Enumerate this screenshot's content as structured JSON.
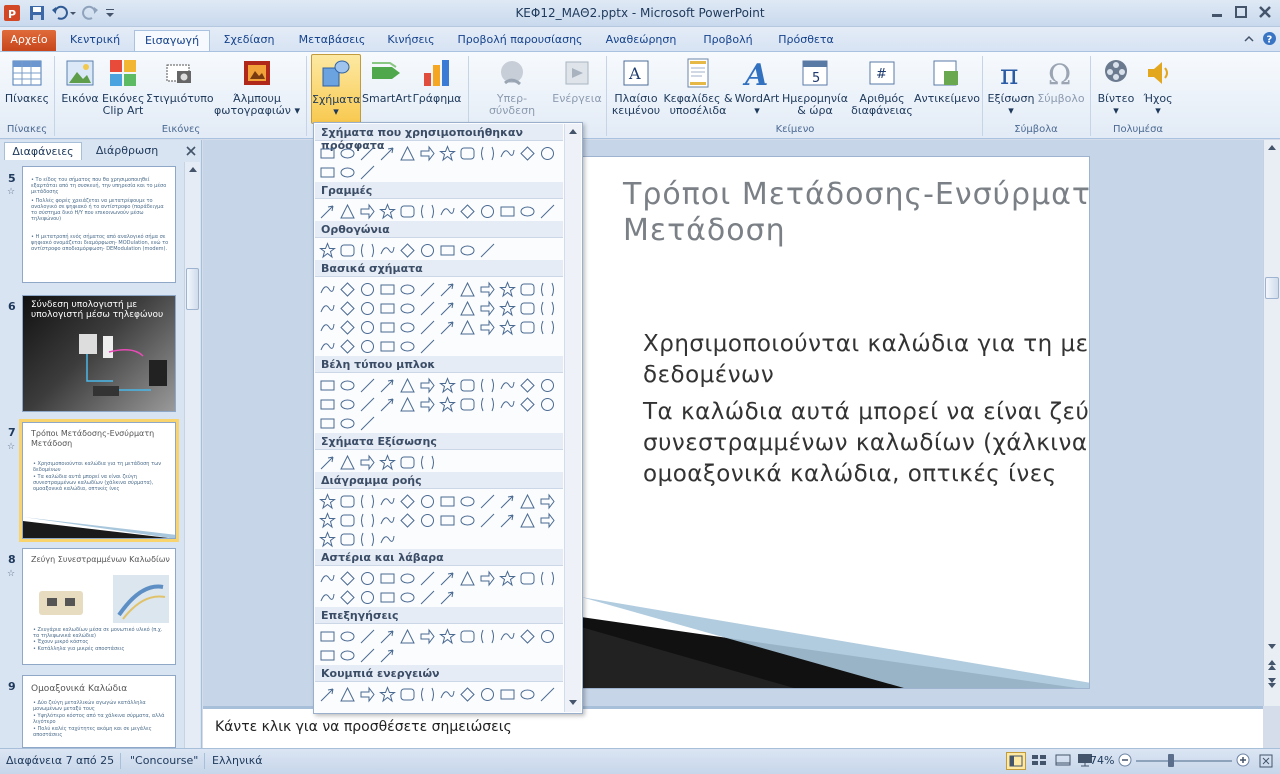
{
  "window": {
    "title": "ΚΕΦ12_ΜΑΘ2.pptx - Microsoft PowerPoint"
  },
  "tabs": [
    "Αρχείο",
    "Κεντρική",
    "Εισαγωγή",
    "Σχεδίαση",
    "Μεταβάσεις",
    "Κινήσεις",
    "Προβολή παρουσίασης",
    "Αναθεώρηση",
    "Προβολή",
    "Πρόσθετα"
  ],
  "ribbon": {
    "tables": {
      "btn": "Πίνακες",
      "group": "Πίνακες"
    },
    "images": {
      "picture": "Εικόνα",
      "clipart1": "Εικόνες",
      "clipart2": "Clip Art",
      "screenshot": "Στιγμιότυπο",
      "album1": "Άλμπουμ",
      "album2": "φωτογραφιών",
      "group": "Εικόνες"
    },
    "illus": {
      "shapes": "Σχήματα",
      "smartart": "SmartArt",
      "chart": "Γράφημα"
    },
    "links": {
      "hyperlink": "Υπερ-σύνδεση",
      "action": "Ενέργεια"
    },
    "text": {
      "textbox1": "Πλαίσιο",
      "textbox2": "κειμένου",
      "header1": "Κεφαλίδες &",
      "header2": "υποσέλιδα",
      "wordart": "WordArt",
      "date1": "Ημερομηνία",
      "date2": "& ώρα",
      "slidenum1": "Αριθμός",
      "slidenum2": "διαφάνειας",
      "object": "Αντικείμενο",
      "group": "Κείμενο"
    },
    "symbols": {
      "equation": "Εξίσωση",
      "symbol": "Σύμβολο",
      "group": "Σύμβολα"
    },
    "media": {
      "video": "Βίντεο",
      "audio": "Ήχος",
      "group": "Πολυμέσα"
    }
  },
  "leftpane": {
    "tabs": [
      "Διαφάνειες",
      "Διάρθρωση"
    ],
    "slides": [
      {
        "num": "5",
        "lines": [
          "• Το είδος του σήματος που θα χρησιμοποιηθεί εξαρτάται από τη συσκευή, την υπηρεσία και το μέσο μετάδοσης",
          "• Πολλές φορές χρειάζεται να μετατρέψουμε το αναλογικό σε ψηφιακό ή το αντίστροφο (παράδειγμα το σύστημα δικό Η/Υ που επικοινωνούν μέσω τηλεφώνου)",
          "• Η μετατροπή ενός σήματος από αναλογικό σήμα σε ψηφιακό ονομάζεται διαμόρφωση- MODulation, ενώ το αντίστροφο αποδιαμόρφωση- DEModulation (modem)."
        ]
      },
      {
        "num": "6",
        "title": "Σύνδεση υπολογιστή με υπολογιστή μέσω τηλεφώνου"
      },
      {
        "num": "7",
        "title": "Τρόποι Μετάδοσης-Ενσύρματη Μετάδοση",
        "lines": [
          "• Χρησιμοποιούνται καλώδια για τη μετάδοση των δεδομένων",
          "• Τα καλώδια αυτά μπορεί να είναι ζεύγη συνεστραμμένων καλωδίων (χάλκινα σύρματα), ομοαξονικά καλώδια, οπτικές ίνες"
        ]
      },
      {
        "num": "8",
        "title": "Ζεύγη Συνεστραμμένων Καλωδίων",
        "lines": [
          "• Ζευγάρια καλωδίων μέσα σε μονωτικό υλικό (π.χ. τα τηλεφωνικά καλώδια)",
          "• Έχουν μικρό κόστος",
          "• Κατάλληλα για μικρές αποστάσεις"
        ]
      },
      {
        "num": "9",
        "title": "Ομοαξονικά Καλώδια",
        "lines": [
          "• Δύο ζεύγη μεταλλικών αγωγών κατάλληλα μονωμένων μεταξύ τους",
          "• Υψηλότερο κόστος από τα χάλκινα σύρματα, αλλά λιγότερο",
          "• Πολύ καλές ταχύτητες ακόμη και σε μεγάλες αποστάσεις"
        ]
      }
    ]
  },
  "slide": {
    "title": "Τρόποι Μετάδοσης-Ενσύρματη Μετάδοση",
    "bullets": [
      "Χρησιμοποιούνται καλώδια για τη μετάδοση των δεδομένων",
      "Τα καλώδια αυτά μπορεί να είναι ζεύγη συνεστραμμένων καλωδίων (χάλκινα σύρματα), ομοαξονικά καλώδια, οπτικές ίνες"
    ]
  },
  "notes": {
    "placeholder": "Κάντε κλικ για να προσθέσετε σημειώσεις"
  },
  "gallery": {
    "sections": [
      "Σχήματα που χρησιμοποιήθηκαν πρόσφατα",
      "Γραμμές",
      "Ορθογώνια",
      "Βασικά σχήματα",
      "Βέλη τύπου μπλοκ",
      "Σχήματα Εξίσωσης",
      "Διάγραμμα ροής",
      "Αστέρια και λάβαρα",
      "Επεξηγήσεις",
      "Κουμπιά ενεργειών"
    ],
    "shape_counts": [
      15,
      12,
      9,
      42,
      27,
      6,
      28,
      19,
      16,
      12
    ]
  },
  "status": {
    "slide": "Διαφάνεια 7 από 25",
    "theme": "\"Concourse\"",
    "lang": "Ελληνικά",
    "zoom": "74%"
  },
  "colors": {
    "accent": "#1e395b",
    "file_tab": "#d35c2c",
    "selection": "#f9d46c"
  }
}
